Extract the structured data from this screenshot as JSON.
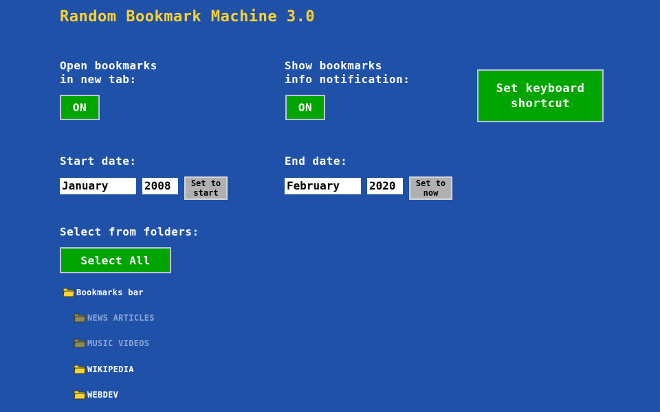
{
  "app": {
    "title": "Random Bookmark Machine 3.0"
  },
  "settings": {
    "open_new_tab": {
      "label": "Open bookmarks\nin new tab:",
      "value": "ON"
    },
    "show_notification": {
      "label": "Show bookmarks\ninfo notification:",
      "value": "ON"
    },
    "keyboard_shortcut": {
      "label": "Set keyboard\nshortcut"
    }
  },
  "start_date": {
    "label": "Start date:",
    "month": "January",
    "year": "2008",
    "button": "Set to\nstart"
  },
  "end_date": {
    "label": "End date:",
    "month": "February",
    "year": "2020",
    "button": "Set to\nnow"
  },
  "folders": {
    "label": "Select from folders:",
    "select_all": "Select All",
    "items": [
      {
        "name": "Bookmarks bar",
        "level": 0,
        "selected": true,
        "icon": "folder-icon"
      },
      {
        "name": "NEWS ARTICLES",
        "level": 1,
        "selected": false,
        "icon": "folder-icon"
      },
      {
        "name": "MUSIC VIDEOS",
        "level": 1,
        "selected": false,
        "icon": "folder-icon"
      },
      {
        "name": "WIKIPEDIA",
        "level": 1,
        "selected": true,
        "icon": "folder-icon"
      },
      {
        "name": "WEBDEV",
        "level": 1,
        "selected": true,
        "icon": "folder-icon"
      }
    ]
  },
  "colors": {
    "background": "#1f51a9",
    "title": "#fcd232",
    "button_green": "#00a500",
    "button_gray": "#b0b0b0",
    "folder_active": "#fcd232",
    "folder_inactive": "#8a8a5a"
  }
}
